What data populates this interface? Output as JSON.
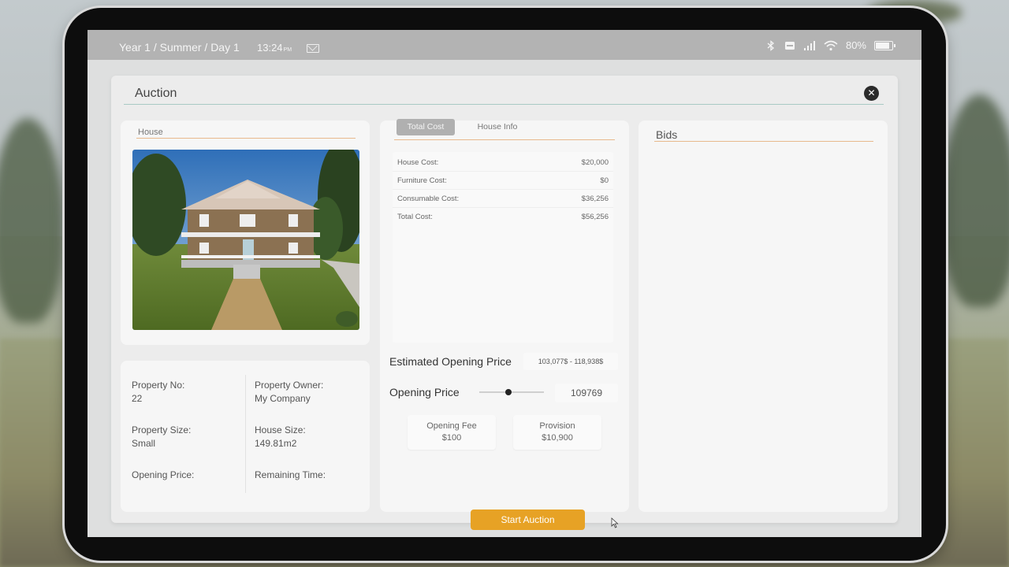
{
  "status_bar": {
    "date": "Year 1 / Summer / Day 1",
    "time": "13:24",
    "time_suffix": "PM",
    "battery": "80%"
  },
  "window": {
    "title": "Auction"
  },
  "house_panel": {
    "label": "House"
  },
  "property": {
    "number_label": "Property No:",
    "number_value": "22",
    "owner_label": "Property Owner:",
    "owner_value": "My Company",
    "size_label": "Property Size:",
    "size_value": "Small",
    "house_size_label": "House Size:",
    "house_size_value": "149.81m2",
    "opening_price_label": "Opening Price:",
    "remaining_time_label": "Remaining Time:"
  },
  "cost_panel": {
    "tabs": [
      "Total Cost",
      "House Info"
    ],
    "rows": [
      {
        "name": "House Cost:",
        "value": "$20,000"
      },
      {
        "name": "Furniture Cost:",
        "value": "$0"
      },
      {
        "name": "Consumable Cost:",
        "value": "$36,256"
      },
      {
        "name": "Total Cost:",
        "value": "$56,256"
      }
    ],
    "estimated_label": "Estimated Opening Price",
    "estimated_value": "103,077$ - 118,938$",
    "opening_label": "Opening Price",
    "opening_value": "109769",
    "slider_level": 0.45,
    "fee_label": "Opening Fee",
    "fee_value": "$100",
    "provision_label": "Provision",
    "provision_value": "$10,900",
    "start_button": "Start Auction"
  },
  "bids_panel": {
    "label": "Bids"
  },
  "colors": {
    "accent": "#e7a225",
    "tab_active": "#b0b0b0"
  }
}
